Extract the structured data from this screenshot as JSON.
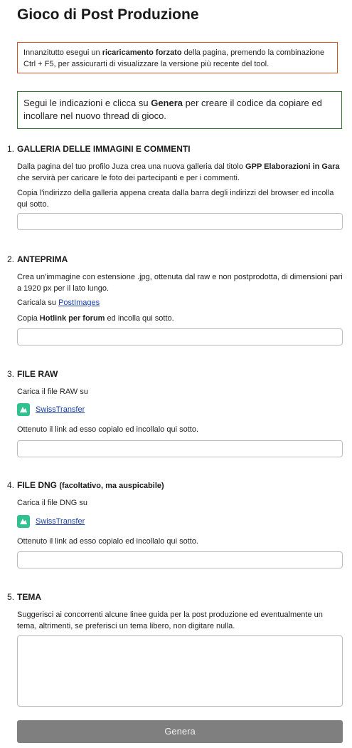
{
  "title": "Gioco di Post Produzione",
  "warning": {
    "before": "Innanzitutto esegui un ",
    "bold": "ricaricamento forzato",
    "after": " della pagina, premendo la combinazione Ctrl + F5, per assicurarti di visualizzare la versione più recente del tool.",
    "border_color": "#d9541e"
  },
  "info": {
    "before": "Segui le indicazioni e clicca su ",
    "bold": "Genera",
    "after": " per creare il codice da copiare ed incollare nel nuovo thread di gioco.",
    "border_color": "#2e7d32"
  },
  "sections": [
    {
      "number": "1.",
      "title": "GALLERIA DELLE IMMAGINI E COMMENTI",
      "p1_before": "Dalla pagina del tuo profilo Juza crea una nuova galleria dal titolo ",
      "p1_bold": "GPP Elaborazioni in Gara",
      "p1_after": " che servirà per caricare le foto dei partecipanti e per i commenti.",
      "p2": "Copia l'indirizzo della galleria appena creata dalla barra degli indirizzi del browser ed incolla qui sotto.",
      "input_value": ""
    },
    {
      "number": "2.",
      "title": "ANTEPRIMA",
      "p1": "Crea un'immagine con estensione .jpg, ottenuta dal raw e non postprodotta, di dimensioni pari a 1920 px per il lato lungo.",
      "p2_before": "Caricala su ",
      "p2_link": "PostImages",
      "p3_before": "Copia ",
      "p3_bold": "Hotlink per forum",
      "p3_after": " ed incolla qui sotto.",
      "input_value": ""
    },
    {
      "number": "3.",
      "title": "FILE RAW",
      "p1": "Carica il file RAW su",
      "link": "SwissTransfer",
      "p2": "Ottenuto il link ad esso copialo ed incollalo qui sotto.",
      "input_value": ""
    },
    {
      "number": "4.",
      "title": "FILE DNG",
      "subtitle": "(facoltativo, ma auspicabile)",
      "p1": "Carica il file DNG su",
      "link": "SwissTransfer",
      "p2": "Ottenuto il link ad esso copialo ed incollalo qui sotto.",
      "input_value": ""
    },
    {
      "number": "5.",
      "title": "TEMA",
      "p1": "Suggerisci ai concorrenti alcune linee guida per la post produzione ed eventualmente un tema, altrimenti, se preferisci un tema libero, non digitare nulla.",
      "textarea_value": ""
    }
  ],
  "button": {
    "label": "Genera",
    "color": "#7f7f7f"
  },
  "icons": {
    "swisstransfer": "swisstransfer-logo-icon"
  }
}
